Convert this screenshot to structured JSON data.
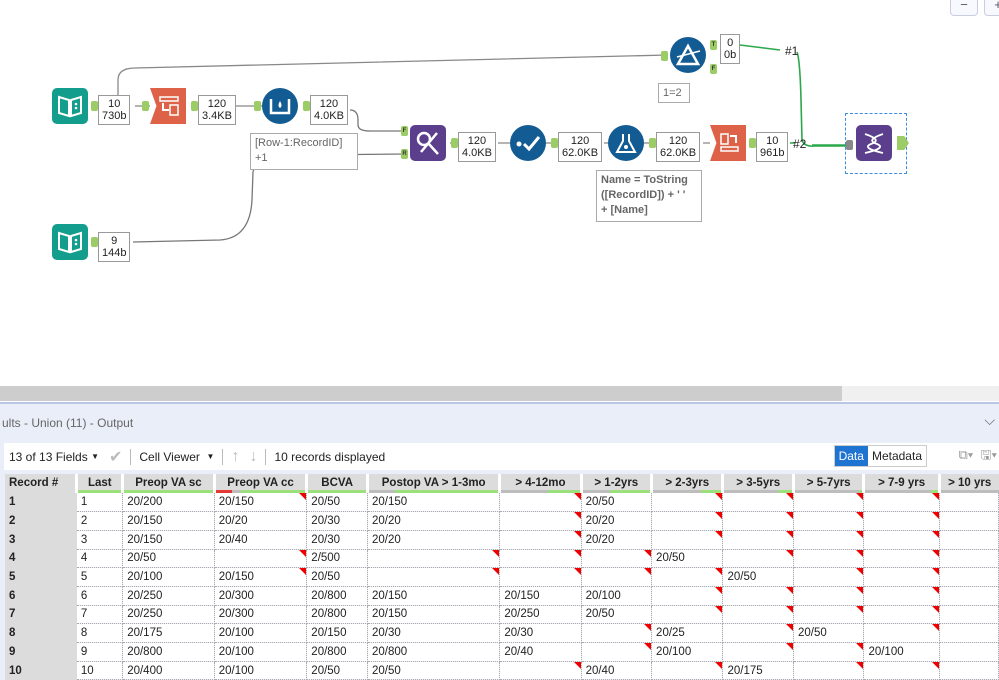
{
  "colors": {
    "teal": "#139d8d",
    "orange": "#dd6248",
    "blue": "#135b93",
    "purple": "#5b3f8c",
    "wire_green": "#2aa84a",
    "null_flag": "#ee0000",
    "accent": "#1f74d1"
  },
  "window_buttons": [
    "−",
    "+"
  ],
  "workflow": {
    "tools": [
      {
        "id": "input1",
        "icon": "book-input-icon"
      },
      {
        "id": "select",
        "icon": "select-records-icon"
      },
      {
        "id": "multirow",
        "icon": "multi-row-formula-icon"
      },
      {
        "id": "input2",
        "icon": "book-input-icon"
      },
      {
        "id": "join",
        "icon": "join-icon"
      },
      {
        "id": "check",
        "icon": "record-id-check-icon"
      },
      {
        "id": "formula",
        "icon": "formula-flask-icon"
      },
      {
        "id": "crosstab",
        "icon": "crosstab-icon"
      },
      {
        "id": "filter",
        "icon": "filter-icon"
      },
      {
        "id": "union",
        "icon": "union-dna-icon"
      }
    ],
    "badges": {
      "input1": [
        "10",
        "730b"
      ],
      "select": [
        "120",
        "3.4KB"
      ],
      "multirow": [
        "120",
        "4.0KB"
      ],
      "input2": [
        "9",
        "144b"
      ],
      "join": [
        "120",
        "4.0KB"
      ],
      "check": [
        "120",
        "62.0KB"
      ],
      "formula": [
        "120",
        "62.0KB"
      ],
      "crosstab": [
        "10",
        "961b"
      ],
      "filter": [
        "0",
        "0b"
      ]
    },
    "annotations": {
      "multirow": [
        "[Row-1:RecordID]",
        "+1"
      ],
      "formula": [
        "Name = ToString",
        "([RecordID]) + ' '",
        "+ [Name]"
      ],
      "filter": [
        "1=2"
      ]
    },
    "anchors": {
      "join_left": "F",
      "join_right": "R",
      "filter_true": "T",
      "filter_false": "F"
    },
    "connection_labels": [
      "#1",
      "#2"
    ]
  },
  "results": {
    "title": "ults - Union (11) - Output",
    "fields_selector": "13 of 13 Fields",
    "cell_viewer": "Cell Viewer",
    "records_displayed": "10 records displayed",
    "view_tabs": [
      "Data",
      "Metadata"
    ],
    "active_view": "Data",
    "columns": [
      {
        "name": "Record #"
      },
      {
        "name": "Last",
        "quality": {
          "red": 0,
          "gray": 0,
          "green": 1
        }
      },
      {
        "name": "Preop VA sc",
        "quality": {
          "red": 0,
          "gray": 0,
          "green": 1
        }
      },
      {
        "name": "Preop VA cc",
        "quality": {
          "red": 0.18,
          "gray": 0.1,
          "green": 0.72
        }
      },
      {
        "name": "BCVA",
        "quality": {
          "red": 0,
          "gray": 0,
          "green": 1
        }
      },
      {
        "name": "Postop VA > 1-3mo",
        "quality": {
          "red": 0,
          "gray": 0.2,
          "green": 0.8
        }
      },
      {
        "name": "> 4-12mo",
        "quality": {
          "red": 0,
          "gray": 0.6,
          "green": 0.4
        }
      },
      {
        "name": "> 1-2yrs",
        "quality": {
          "red": 0,
          "gray": 0.4,
          "green": 0.6
        }
      },
      {
        "name": "> 2-3yrs",
        "quality": {
          "red": 0,
          "gray": 0.7,
          "green": 0.3
        }
      },
      {
        "name": "> 3-5yrs",
        "quality": {
          "red": 0,
          "gray": 0.8,
          "green": 0.2
        }
      },
      {
        "name": "> 5-7yrs",
        "quality": {
          "red": 0,
          "gray": 0.95,
          "green": 0.05
        }
      },
      {
        "name": "> 7-9 yrs",
        "quality": {
          "red": 0,
          "gray": 0.9,
          "green": 0.1
        }
      },
      {
        "name": "> 10 yrs",
        "quality": {
          "red": 0,
          "gray": 1,
          "green": 0
        }
      }
    ],
    "rows": [
      {
        "rec": "1",
        "cells": [
          "1",
          "20/200",
          "20/150",
          "20/50",
          "20/150",
          "",
          "20/50",
          "",
          "",
          "",
          "",
          ""
        ],
        "flags": [
          2,
          5,
          7,
          8,
          9,
          10
        ]
      },
      {
        "rec": "2",
        "cells": [
          "2",
          "20/150",
          "20/20",
          "20/30",
          "20/20",
          "",
          "20/20",
          "",
          "",
          "",
          "",
          ""
        ],
        "flags": [
          5,
          7,
          8,
          9,
          10
        ]
      },
      {
        "rec": "3",
        "cells": [
          "3",
          "20/150",
          "20/40",
          "20/30",
          "20/20",
          "",
          "20/20",
          "",
          "",
          "",
          "",
          ""
        ],
        "flags": [
          5,
          7,
          8,
          9,
          10
        ]
      },
      {
        "rec": "4",
        "cells": [
          "4",
          "20/50",
          "",
          "2/500",
          "",
          "",
          "",
          "20/50",
          "",
          "",
          "",
          ""
        ],
        "flags": [
          2,
          4,
          5,
          6,
          8,
          9,
          10
        ]
      },
      {
        "rec": "5",
        "cells": [
          "5",
          "20/100",
          "20/150",
          "20/50",
          "",
          "",
          "",
          "",
          "20/50",
          "",
          "",
          ""
        ],
        "flags": [
          2,
          4,
          5,
          6,
          7,
          9,
          10
        ]
      },
      {
        "rec": "6",
        "cells": [
          "6",
          "20/250",
          "20/300",
          "20/800",
          "20/150",
          "20/150",
          "20/100",
          "",
          "",
          "",
          "",
          ""
        ],
        "flags": [
          7,
          8,
          9,
          10
        ]
      },
      {
        "rec": "7",
        "cells": [
          "7",
          "20/250",
          "20/300",
          "20/800",
          "20/150",
          "20/250",
          "20/50",
          "",
          "",
          "",
          "",
          ""
        ],
        "flags": [
          7,
          8,
          9,
          10
        ]
      },
      {
        "rec": "8",
        "cells": [
          "8",
          "20/175",
          "20/100",
          "20/150",
          "20/30",
          "20/30",
          "",
          "20/25",
          "",
          "20/50",
          "",
          ""
        ],
        "flags": [
          6,
          8,
          10
        ]
      },
      {
        "rec": "9",
        "cells": [
          "9",
          "20/800",
          "20/100",
          "20/800",
          "20/800",
          "20/40",
          "",
          "20/100",
          "",
          "",
          "20/100",
          ""
        ],
        "flags": [
          6,
          8,
          9
        ]
      },
      {
        "rec": "10",
        "cells": [
          "10",
          "20/400",
          "20/100",
          "20/50",
          "20/50",
          "",
          "20/40",
          "",
          "20/175",
          "",
          "",
          ""
        ],
        "flags": [
          5,
          7,
          9,
          10
        ]
      }
    ]
  }
}
